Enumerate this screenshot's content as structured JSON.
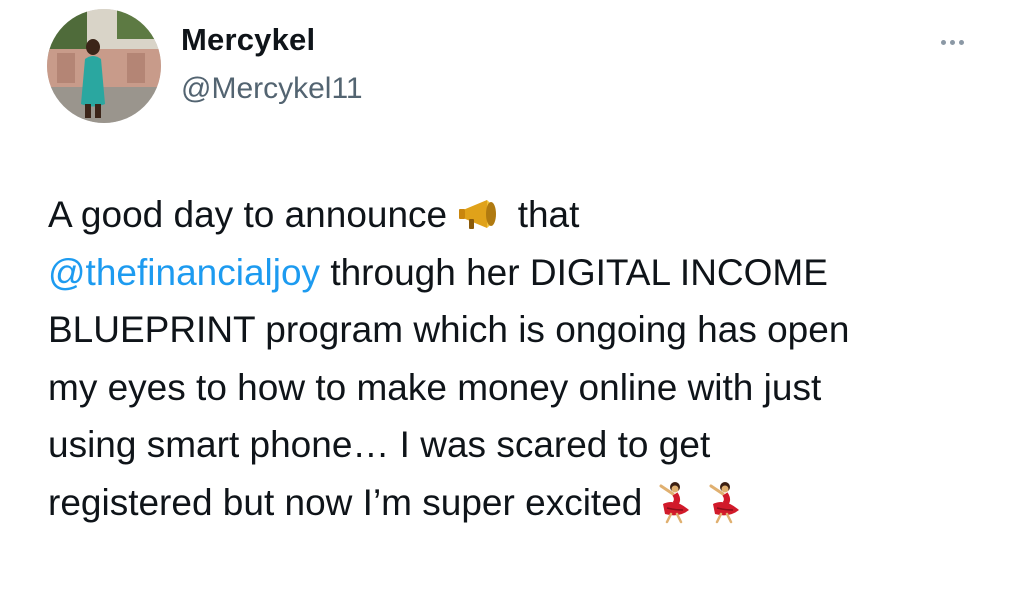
{
  "user": {
    "display_name": "Mercykel",
    "handle": "@Mercykel11",
    "avatar_icon": "profile-photo-avatar"
  },
  "menu": {
    "more_icon": "ellipsis-icon"
  },
  "tweet": {
    "line1_a": "A good day to announce",
    "line1_b": "that",
    "mention": "@thefinancialjoy",
    "line2_rest": " through her DIGITAL INCOME",
    "line3": "BLUEPRINT program which is ongoing has open",
    "line4": "my eyes to how to make money online with just",
    "line5": "using smart phone… I was scared to get",
    "line6": "registered but now I’m super excited",
    "emojis": [
      "megaphone-emoji",
      "dancer-emoji",
      "dancer-emoji"
    ]
  },
  "colors": {
    "text": "#0f1419",
    "secondary": "#536471",
    "link": "#1d9bf0",
    "background": "#ffffff"
  }
}
